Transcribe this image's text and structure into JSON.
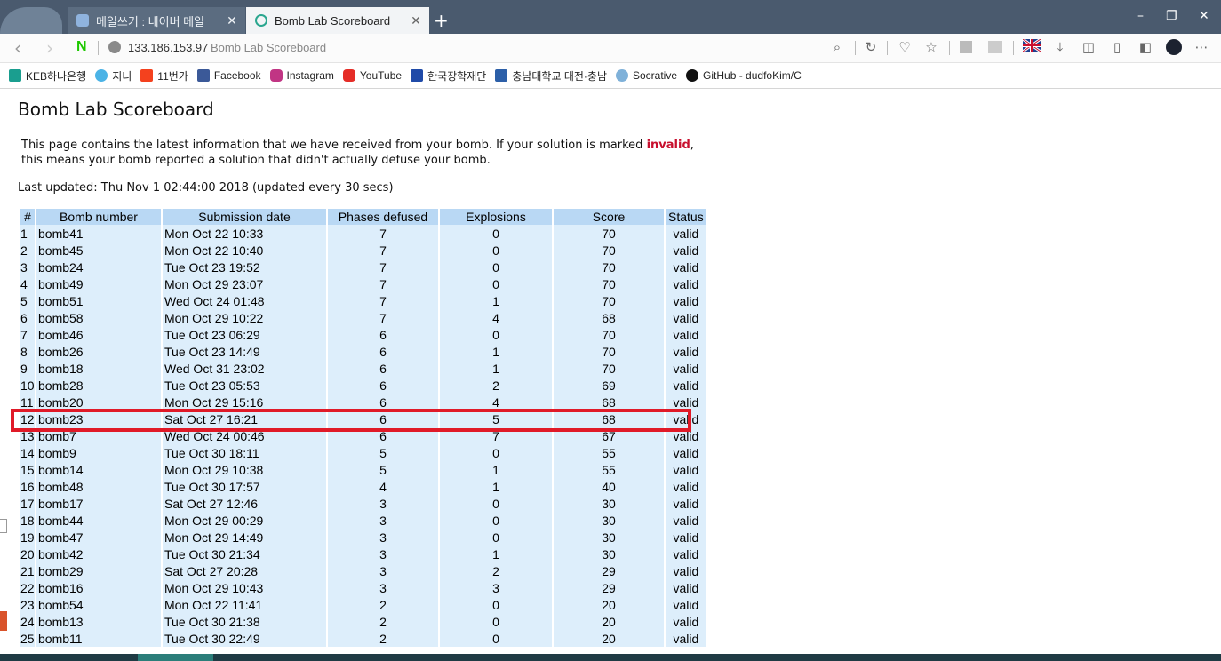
{
  "browser": {
    "tabs": [
      {
        "label": "메일쓰기 : 네이버 메일",
        "active": false,
        "icon": "naver-mail-icon",
        "close": "✕"
      },
      {
        "label": "Bomb Lab Scoreboard",
        "active": true,
        "icon": "globe-tab-icon",
        "close": "✕"
      }
    ],
    "new_tab": "+",
    "window_controls": {
      "minimize": "–",
      "restore": "❐",
      "close": "✕"
    },
    "address": {
      "host": "133.186.153.97",
      "title": "Bomb Lab Scoreboard"
    }
  },
  "bookmarks": [
    {
      "label": "KEB하나은행",
      "icon": "keb-icon",
      "color": "#1a9e8f"
    },
    {
      "label": "지니",
      "icon": "genie-icon",
      "color": "#4bb3e6"
    },
    {
      "label": "11번가",
      "icon": "11st-icon",
      "color": "#f4411e"
    },
    {
      "label": "Facebook",
      "icon": "facebook-icon",
      "color": "#3b5998"
    },
    {
      "label": "Instagram",
      "icon": "instagram-icon",
      "color": "#c13584"
    },
    {
      "label": "YouTube",
      "icon": "youtube-icon",
      "color": "#e52d27"
    },
    {
      "label": "한국장학재단",
      "icon": "kosaf-icon",
      "color": "#1f4aa8"
    },
    {
      "label": "충남대학교 대전·충남",
      "icon": "cnu-icon",
      "color": "#2c5fa8"
    },
    {
      "label": "Socrative",
      "icon": "socrative-icon",
      "color": "#7fb1d9"
    },
    {
      "label": "GitHub - dudfoKim/C",
      "icon": "github-icon",
      "color": "#111111"
    }
  ],
  "page": {
    "title": "Bomb Lab Scoreboard",
    "intro_1": "This page contains the latest information that we have received from your bomb. If your solution is marked ",
    "intro_invalid": "invalid",
    "intro_2": ",",
    "intro_3": "this means your bomb reported a solution that didn't actually defuse your bomb.",
    "last_updated": "Last updated: Thu Nov 1 02:44:00 2018 (updated every 30 secs)"
  },
  "table": {
    "headers": [
      "#",
      "Bomb number",
      "Submission date",
      "Phases defused",
      "Explosions",
      "Score",
      "Status"
    ],
    "rows": [
      [
        "1",
        "bomb41",
        "Mon Oct 22 10:33",
        "7",
        "0",
        "70",
        "valid"
      ],
      [
        "2",
        "bomb45",
        "Mon Oct 22 10:40",
        "7",
        "0",
        "70",
        "valid"
      ],
      [
        "3",
        "bomb24",
        "Tue Oct 23 19:52",
        "7",
        "0",
        "70",
        "valid"
      ],
      [
        "4",
        "bomb49",
        "Mon Oct 29 23:07",
        "7",
        "0",
        "70",
        "valid"
      ],
      [
        "5",
        "bomb51",
        "Wed Oct 24 01:48",
        "7",
        "1",
        "70",
        "valid"
      ],
      [
        "6",
        "bomb58",
        "Mon Oct 29 10:22",
        "7",
        "4",
        "68",
        "valid"
      ],
      [
        "7",
        "bomb46",
        "Tue Oct 23 06:29",
        "6",
        "0",
        "70",
        "valid"
      ],
      [
        "8",
        "bomb26",
        "Tue Oct 23 14:49",
        "6",
        "1",
        "70",
        "valid"
      ],
      [
        "9",
        "bomb18",
        "Wed Oct 31 23:02",
        "6",
        "1",
        "70",
        "valid"
      ],
      [
        "10",
        "bomb28",
        "Tue Oct 23 05:53",
        "6",
        "2",
        "69",
        "valid"
      ],
      [
        "11",
        "bomb20",
        "Mon Oct 29 15:16",
        "6",
        "4",
        "68",
        "valid"
      ],
      [
        "12",
        "bomb23",
        "Sat Oct 27 16:21",
        "6",
        "5",
        "68",
        "valid"
      ],
      [
        "13",
        "bomb7",
        "Wed Oct 24 00:46",
        "6",
        "7",
        "67",
        "valid"
      ],
      [
        "14",
        "bomb9",
        "Tue Oct 30 18:11",
        "5",
        "0",
        "55",
        "valid"
      ],
      [
        "15",
        "bomb14",
        "Mon Oct 29 10:38",
        "5",
        "1",
        "55",
        "valid"
      ],
      [
        "16",
        "bomb48",
        "Tue Oct 30 17:57",
        "4",
        "1",
        "40",
        "valid"
      ],
      [
        "17",
        "bomb17",
        "Sat Oct 27 12:46",
        "3",
        "0",
        "30",
        "valid"
      ],
      [
        "18",
        "bomb44",
        "Mon Oct 29 00:29",
        "3",
        "0",
        "30",
        "valid"
      ],
      [
        "19",
        "bomb47",
        "Mon Oct 29 14:49",
        "3",
        "0",
        "30",
        "valid"
      ],
      [
        "20",
        "bomb42",
        "Tue Oct 30 21:34",
        "3",
        "1",
        "30",
        "valid"
      ],
      [
        "21",
        "bomb29",
        "Sat Oct 27 20:28",
        "3",
        "2",
        "29",
        "valid"
      ],
      [
        "22",
        "bomb16",
        "Mon Oct 29 10:43",
        "3",
        "3",
        "29",
        "valid"
      ],
      [
        "23",
        "bomb54",
        "Mon Oct 22 11:41",
        "2",
        "0",
        "20",
        "valid"
      ],
      [
        "24",
        "bomb13",
        "Tue Oct 30 21:38",
        "2",
        "0",
        "20",
        "valid"
      ],
      [
        "25",
        "bomb11",
        "Tue Oct 30 22:49",
        "2",
        "0",
        "20",
        "valid"
      ]
    ],
    "highlighted_row": "12",
    "highlight_color": "#e01a28"
  },
  "colors": {
    "tabbar": "#4a5a6e",
    "header_bg": "#b9d8f4",
    "cell_bg": "#ddeefb",
    "invalid": "#c8102e"
  }
}
